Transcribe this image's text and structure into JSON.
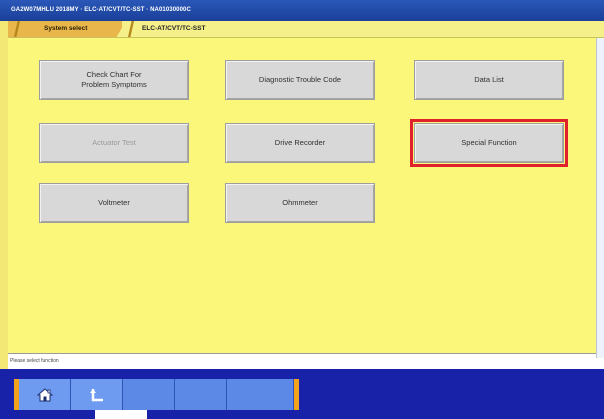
{
  "window": {
    "title": "GA2W07MHLU 2018MY  ·  ELC-AT/CVT/TC-SST  ·  NA01030000C"
  },
  "breadcrumb": {
    "items": [
      {
        "label": "System select"
      },
      {
        "label": "ELC-AT/CVT/TC-SST"
      }
    ]
  },
  "functions": [
    {
      "label": "Check Chart For\nProblem Symptoms",
      "state": "enabled"
    },
    {
      "label": "Diagnostic Trouble Code",
      "state": "enabled"
    },
    {
      "label": "Data List",
      "state": "enabled"
    },
    {
      "label": "Actuator Test",
      "state": "disabled"
    },
    {
      "label": "Drive Recorder",
      "state": "enabled"
    },
    {
      "label": "Special Function",
      "state": "selected"
    },
    {
      "label": "Voltmeter",
      "state": "enabled"
    },
    {
      "label": "Ohmmeter",
      "state": "enabled"
    }
  ],
  "status": {
    "message": "Please select function"
  },
  "toolbar": {
    "buttons": [
      {
        "icon": "home-icon"
      },
      {
        "icon": "back-icon"
      },
      {
        "icon": ""
      },
      {
        "icon": ""
      },
      {
        "icon": ""
      }
    ]
  },
  "colors": {
    "background": "#fbf77a",
    "titlebar": "#1a3f99",
    "selection": "#e0202a",
    "toolbar": "#1722a8"
  }
}
